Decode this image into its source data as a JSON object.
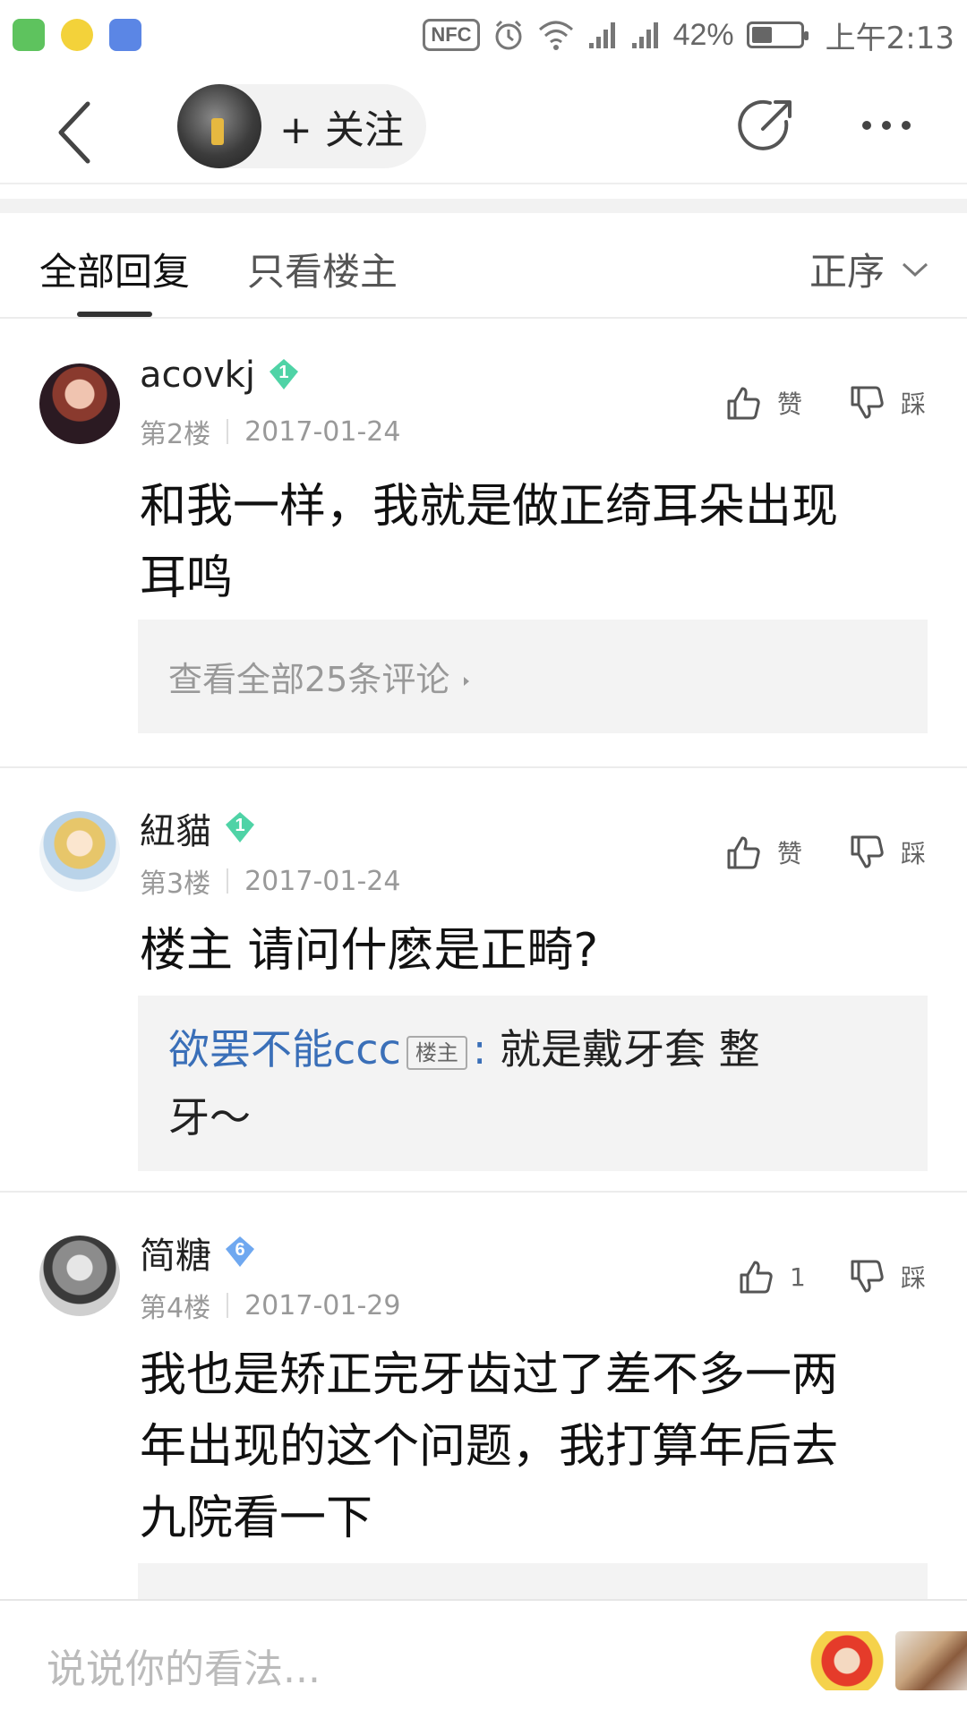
{
  "status_bar": {
    "nfc": "NFC",
    "battery_percent": "42%",
    "battery_level": 0.42,
    "time": "上午2:13"
  },
  "nav": {
    "follow_label": "+ 关注"
  },
  "tabs": {
    "all": "全部回复",
    "op_only": "只看楼主",
    "sort": "正序"
  },
  "posts": [
    {
      "username": "acovkj",
      "level": "1",
      "level_color": "#4fd3a6",
      "floor": "第2楼",
      "date": "2017-01-24",
      "like_label": "赞",
      "dislike_label": "踩",
      "content_lines": [
        "和我一样，我就是做正绮耳朵出现",
        "耳鸣"
      ],
      "view_all": "查看全部25条评论"
    },
    {
      "username": "紐貓",
      "level": "1",
      "level_color": "#4fd3a6",
      "floor": "第3楼",
      "date": "2017-01-24",
      "like_label": "赞",
      "dislike_label": "踩",
      "content_lines": [
        "楼主 请问什麽是正畸?"
      ],
      "reply": {
        "name": "欲罢不能ccc",
        "badge": "楼主",
        "colon": ":",
        "line1": " 就是戴牙套 整",
        "line2": "牙～"
      }
    },
    {
      "username": "简糖",
      "level": "6",
      "level_color": "#6fa8f0",
      "floor": "第4楼",
      "date": "2017-01-29",
      "like_label": "1",
      "dislike_label": "踩",
      "content_lines": [
        "我也是矫正完牙齿过了差不多一两",
        "年出现的这个问题，我打算年后去",
        "九院看一下"
      ]
    }
  ],
  "input": {
    "placeholder": "说说你的看法..."
  }
}
